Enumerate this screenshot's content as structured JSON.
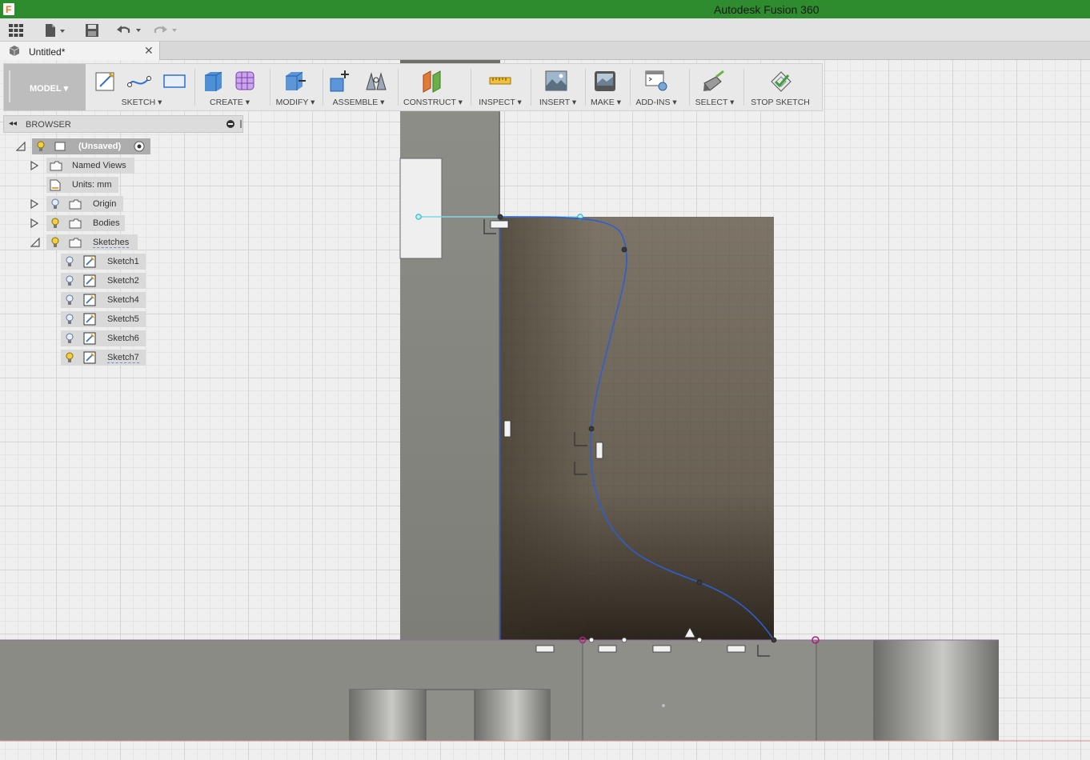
{
  "app": {
    "title": "Autodesk Fusion 360",
    "logo_letter": "F"
  },
  "quick_access": {
    "items": [
      {
        "name": "data-panel",
        "icon": "grid-icon"
      },
      {
        "name": "file-menu",
        "icon": "file-icon"
      },
      {
        "name": "save",
        "icon": "save-icon"
      },
      {
        "name": "undo",
        "icon": "undo-icon"
      },
      {
        "name": "redo",
        "icon": "redo-icon"
      }
    ]
  },
  "document_tab": {
    "label": "Untitled*",
    "close": "✕"
  },
  "toolbar": {
    "mode": "MODEL ▾",
    "groups": [
      {
        "label": "SKETCH ▾"
      },
      {
        "label": "CREATE ▾"
      },
      {
        "label": "MODIFY ▾"
      },
      {
        "label": "ASSEMBLE ▾"
      },
      {
        "label": "CONSTRUCT ▾"
      },
      {
        "label": "INSPECT ▾"
      },
      {
        "label": "INSERT ▾"
      },
      {
        "label": "MAKE ▾"
      },
      {
        "label": "ADD-INS ▾"
      },
      {
        "label": "SELECT ▾"
      },
      {
        "label": "STOP SKETCH"
      }
    ]
  },
  "browser": {
    "title": "BROWSER",
    "back": "◂◂",
    "root": "(Unsaved)",
    "nodes": [
      {
        "label": "Named Views",
        "expandable": true
      },
      {
        "label": "Units: mm",
        "expandable": false
      },
      {
        "label": "Origin",
        "expandable": true
      },
      {
        "label": "Bodies",
        "expandable": true
      },
      {
        "label": "Sketches",
        "expandable": true,
        "expanded": true
      }
    ],
    "sketches": [
      {
        "label": "Sketch1",
        "visible": false
      },
      {
        "label": "Sketch2",
        "visible": false
      },
      {
        "label": "Sketch4",
        "visible": false
      },
      {
        "label": "Sketch5",
        "visible": false
      },
      {
        "label": "Sketch6",
        "visible": false
      },
      {
        "label": "Sketch7",
        "visible": true
      }
    ]
  },
  "colors": {
    "titlebar": "#2e8b2e",
    "spline": "#2d5fd0",
    "construction_line": "#7fd8e6",
    "body_face": "#6b6358",
    "wall": "#8a8a85"
  }
}
